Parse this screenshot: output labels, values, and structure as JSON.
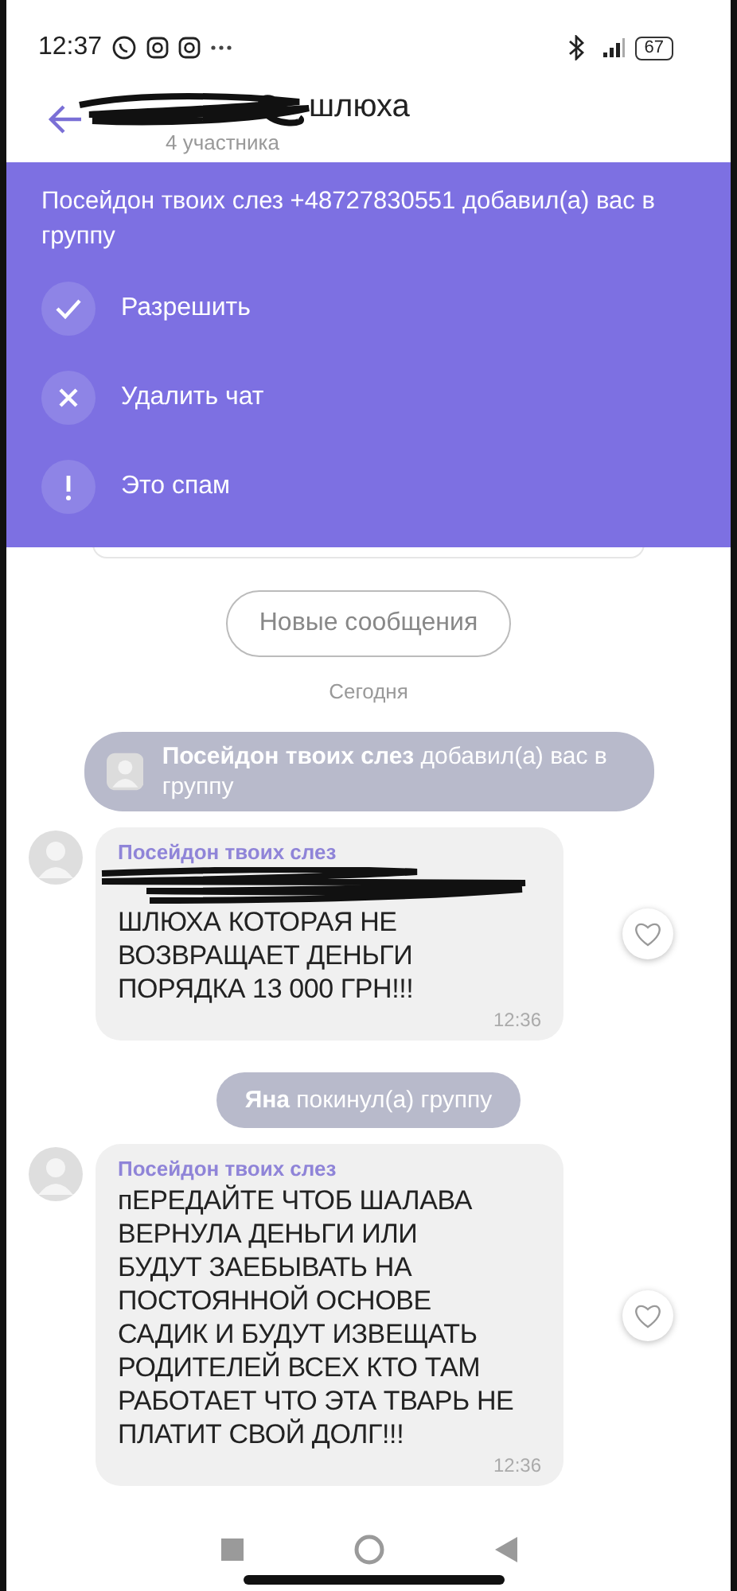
{
  "status_bar": {
    "time": "12:37",
    "battery": "67"
  },
  "header": {
    "title": "шлюха",
    "title_redacted": true,
    "subtitle": "4 участника"
  },
  "invite_banner": {
    "text": "Посейдон твоих слез +48727830551 добавил(а) вас в группу",
    "actions": [
      {
        "kind": "allow",
        "label": "Разрешить"
      },
      {
        "kind": "delete",
        "label": "Удалить чат"
      },
      {
        "kind": "spam",
        "label": "Это спам"
      }
    ]
  },
  "new_messages_button": "Новые сообщения",
  "date_label": "Сегодня",
  "messages": [
    {
      "kind": "system",
      "avatar": true,
      "text": "**Посейдон твоих слез** добавил(а) вас в группу"
    },
    {
      "kind": "incoming",
      "sender": "Посейдон твоих слез",
      "redacted": true,
      "text": "ШЛЮХА КОТОРАЯ НЕ\nВОЗВРАЩАЕТ ДЕНЬГИ\nПОРЯДКА 13 000 ГРН!!!",
      "time": "12:36"
    },
    {
      "kind": "system",
      "avatar": false,
      "text": "**Яна** покинул(а) группу"
    },
    {
      "kind": "incoming",
      "sender": "Посейдон твоих слез",
      "redacted": false,
      "text": "пЕРЕДАЙТЕ ЧТОБ ШАЛАВА\nВЕРНУЛА ДЕНЬГИ ИЛИ\nБУДУТ ЗАЕБЫВАТЬ НА\nПОСТОЯННОЙ ОСНОВЕ\nСАДИК И БУДУТ ИЗВЕЩАТЬ\nРОДИТЕЛЕЙ ВСЕХ КТО ТАМ\nРАБОТАЕТ ЧТО ЭТА ТВАРЬ НЕ\nПЛАТИТ СВОЙ ДОЛГ!!!",
      "time": "12:36"
    }
  ]
}
